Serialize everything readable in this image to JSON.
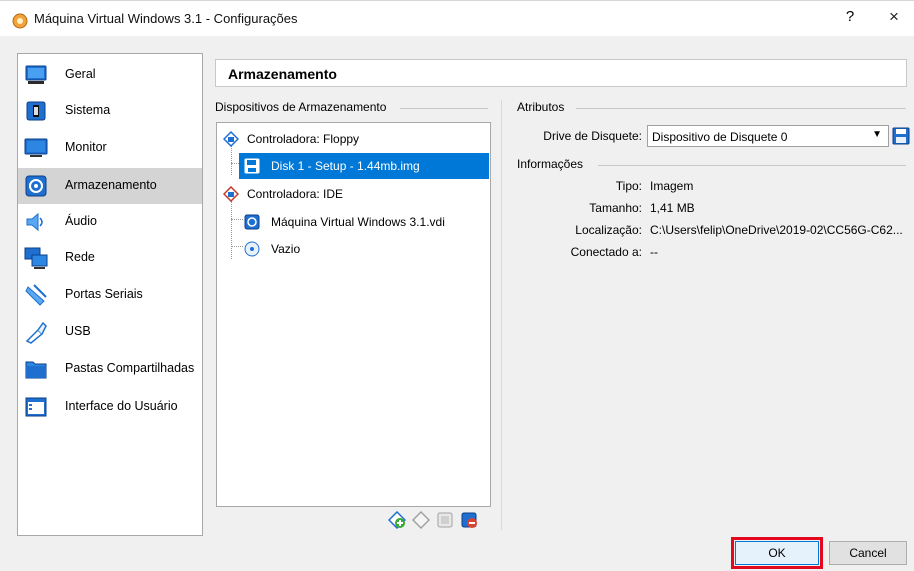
{
  "window": {
    "title": "Máquina Virtual Windows 3.1 - Configurações",
    "help_glyph": "?",
    "close_glyph": "×"
  },
  "nav": {
    "items": [
      {
        "label": "Geral",
        "icon": "general-icon"
      },
      {
        "label": "Sistema",
        "icon": "system-icon"
      },
      {
        "label": "Monitor",
        "icon": "display-icon"
      },
      {
        "label": "Armazenamento",
        "icon": "storage-icon",
        "selected": true
      },
      {
        "label": "Áudio",
        "icon": "audio-icon"
      },
      {
        "label": "Rede",
        "icon": "network-icon"
      },
      {
        "label": "Portas Seriais",
        "icon": "serial-ports-icon"
      },
      {
        "label": "USB",
        "icon": "usb-icon"
      },
      {
        "label": "Pastas Compartilhadas",
        "icon": "shared-folders-icon"
      },
      {
        "label": "Interface do Usuário",
        "icon": "user-interface-icon"
      }
    ]
  },
  "section": {
    "title": "Armazenamento"
  },
  "devices": {
    "group_label": "Dispositivos de Armazenamento",
    "tree": [
      {
        "label": "Controladora: Floppy",
        "type": "controller"
      },
      {
        "label": "Disk 1 - Setup - 1.44mb.img",
        "type": "floppy",
        "selected": true
      },
      {
        "label": "Controladora: IDE",
        "type": "controller"
      },
      {
        "label": "Máquina Virtual Windows 3.1.vdi",
        "type": "hard-disk"
      },
      {
        "label": "Vazio",
        "type": "optical"
      }
    ],
    "tools": [
      "add-controller-icon",
      "remove-controller-icon",
      "add-attachment-icon",
      "remove-attachment-icon"
    ]
  },
  "attributes": {
    "group_label": "Atributos",
    "drive_label": "Drive de Disquete:",
    "drive_value": "Dispositivo de Disquete 0"
  },
  "info": {
    "group_label": "Informações",
    "rows": [
      {
        "label": "Tipo:",
        "value": "Imagem"
      },
      {
        "label": "Tamanho:",
        "value": "1,41 MB"
      },
      {
        "label": "Localização:",
        "value": "C:\\Users\\felip\\OneDrive\\2019-02\\CC56G-C62..."
      },
      {
        "label": "Conectado a:",
        "value": "--"
      }
    ]
  },
  "buttons": {
    "ok": "OK",
    "cancel": "Cancel"
  },
  "colors": {
    "selection": "#0078d7",
    "highlight_border": "#e3081e",
    "nav_selected": "#d4d4d4"
  }
}
